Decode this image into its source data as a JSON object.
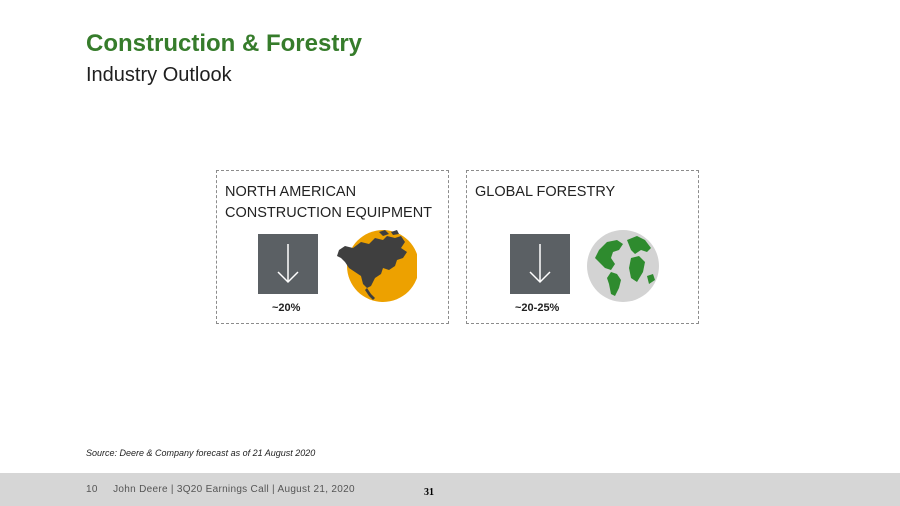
{
  "header": {
    "title": "Construction & Forestry",
    "subtitle": "Industry Outlook"
  },
  "cards": [
    {
      "title_line1": "NORTH AMERICAN",
      "title_line2": "CONSTRUCTION EQUIPMENT",
      "value": "~20%",
      "icon": "north-america-map-icon",
      "trend_icon": "down-arrow-icon"
    },
    {
      "title_line1": "GLOBAL FORESTRY",
      "value": "~20-25%",
      "icon": "globe-icon",
      "trend_icon": "down-arrow-icon"
    }
  ],
  "source": "Source: Deere & Company forecast as of 21 August 2020",
  "footer": {
    "text": "10     John Deere | 3Q20 Earnings Call | August 21, 2020",
    "page_number": "31"
  },
  "colors": {
    "accent_green": "#367c2b",
    "arrow_box": "#5b6064",
    "map_circle": "#eda100",
    "globe_circle": "#d3d3d3"
  }
}
